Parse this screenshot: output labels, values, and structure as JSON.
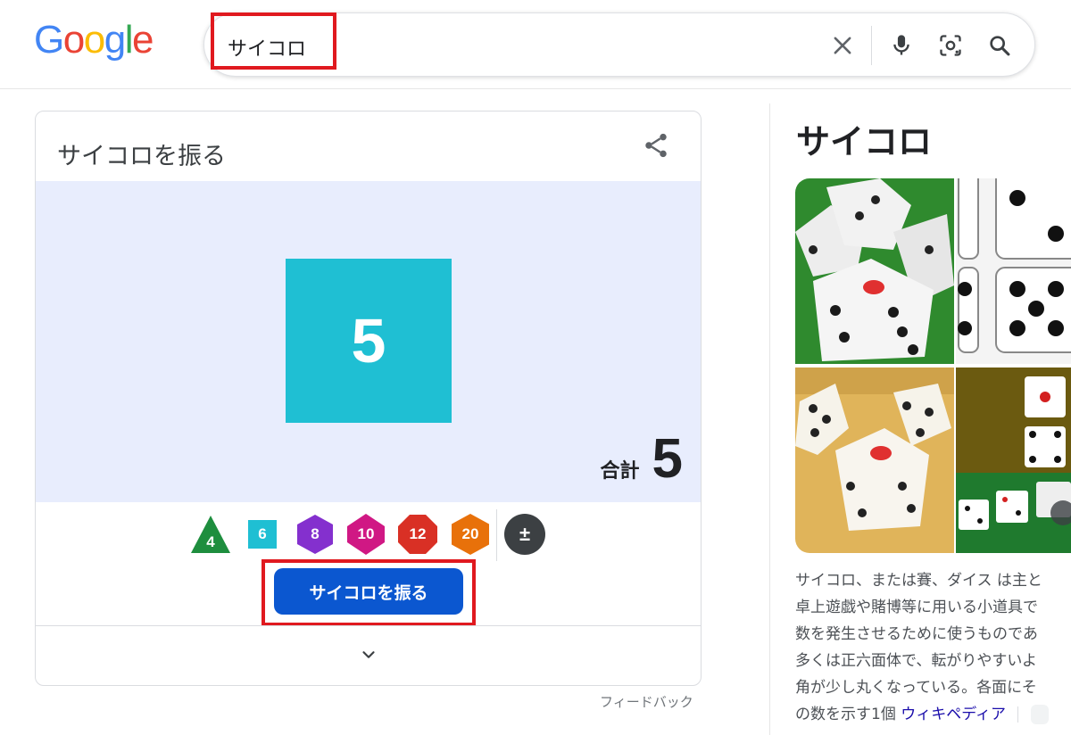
{
  "header": {
    "logo_letters": [
      "G",
      "o",
      "o",
      "g",
      "l",
      "e"
    ],
    "logo_colors": [
      "#4285F4",
      "#EA4335",
      "#FBBC05",
      "#4285F4",
      "#34A853",
      "#EA4335"
    ],
    "search": {
      "query": "サイコロ"
    },
    "icons": [
      "close-icon",
      "microphone-icon",
      "camera-lens-icon",
      "search-icon"
    ]
  },
  "dice_card": {
    "title": "サイコロを振る",
    "die_value": "5",
    "total_label": "合計",
    "total_value": "5",
    "die_types": [
      {
        "label": "4",
        "shape": "triangle",
        "color": "#1e8e3e"
      },
      {
        "label": "6",
        "shape": "square",
        "color": "#1fbfd3"
      },
      {
        "label": "8",
        "shape": "hexagon",
        "color": "#8430ce"
      },
      {
        "label": "10",
        "shape": "diamond-hexagon",
        "color": "#d01884"
      },
      {
        "label": "12",
        "shape": "octagon",
        "color": "#d93025"
      },
      {
        "label": "20",
        "shape": "hexagon",
        "color": "#e8710a"
      },
      {
        "label": "±",
        "shape": "circle",
        "color": "#3c4043"
      }
    ],
    "roll_button": "サイコロを振る",
    "feedback": "フィードバック"
  },
  "knowledge_panel": {
    "title": "サイコロ",
    "description_lines": [
      "サイコロ、または賽、ダイス は主と",
      "卓上遊戯や賭博等に用いる小道具で",
      "数を発生させるために使うものであ",
      "多くは正六面体で、転がりやすいよ",
      "角が少し丸くなっている。各面にそ"
    ],
    "last_line_text": "の数を示す1個",
    "source_link": "ウィキペディア",
    "accent_colors": {
      "highlight": "#e0191f",
      "button": "#0b57d0"
    }
  }
}
